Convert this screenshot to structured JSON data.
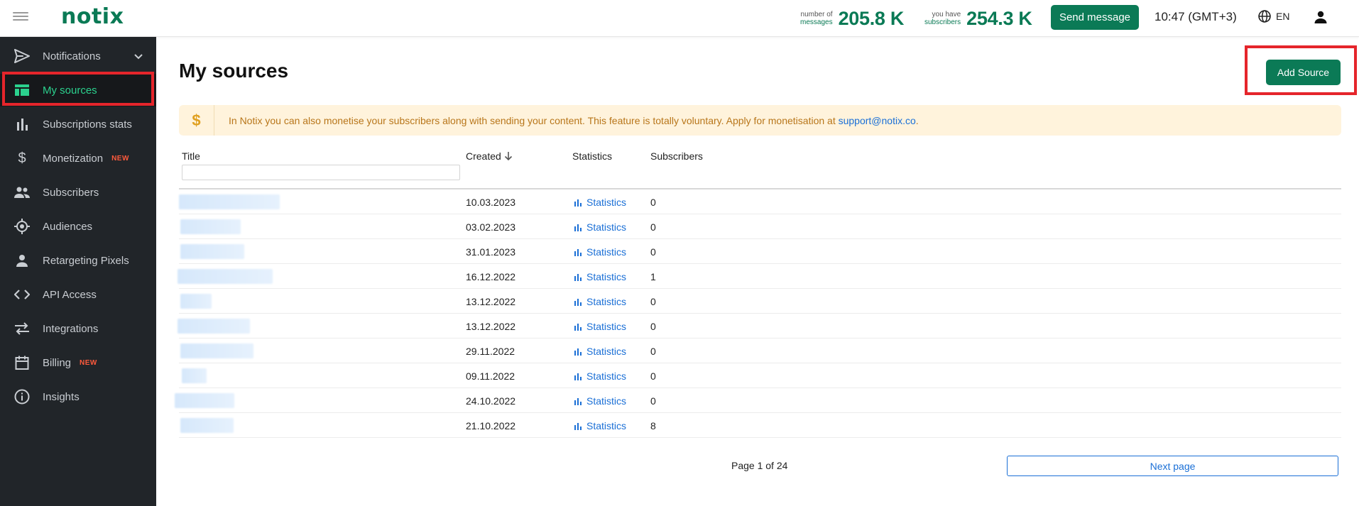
{
  "header": {
    "logo": "notix",
    "messages_label_1": "number of",
    "messages_label_2": "messages",
    "messages_value": "205.8 K",
    "subscribers_label_1": "you have",
    "subscribers_label_2": "subscribers",
    "subscribers_value": "254.3 K",
    "send_button": "Send message",
    "time": "10:47 (GMT+3)",
    "language": "EN"
  },
  "sidebar": {
    "items": [
      {
        "label": "Notifications",
        "icon": "send-icon"
      },
      {
        "label": "My sources",
        "icon": "table-icon",
        "active": true
      },
      {
        "label": "Subscriptions stats",
        "icon": "bar-chart-icon"
      },
      {
        "label": "Monetization",
        "icon": "dollar-icon",
        "badge": "NEW"
      },
      {
        "label": "Subscribers",
        "icon": "people-icon"
      },
      {
        "label": "Audiences",
        "icon": "target-icon"
      },
      {
        "label": "Retargeting Pixels",
        "icon": "person-icon"
      },
      {
        "label": "API Access",
        "icon": "code-icon"
      },
      {
        "label": "Integrations",
        "icon": "swap-icon"
      },
      {
        "label": "Billing",
        "icon": "calendar-icon",
        "badge": "NEW"
      },
      {
        "label": "Insights",
        "icon": "info-icon"
      }
    ]
  },
  "main": {
    "title": "My sources",
    "add_button": "Add Source",
    "banner_text": "In Notix you can also monetise your subscribers along with sending your content. This feature is totally voluntary. Apply for monetisation at ",
    "banner_link": "support@notix.co",
    "banner_end": ".",
    "columns": {
      "title": "Title",
      "created": "Created",
      "statistics": "Statistics",
      "subscribers": "Subscribers"
    },
    "rows": [
      {
        "created": "10.03.2023",
        "stat": "Statistics",
        "subscribers": "0"
      },
      {
        "created": "03.02.2023",
        "stat": "Statistics",
        "subscribers": "0"
      },
      {
        "created": "31.01.2023",
        "stat": "Statistics",
        "subscribers": "0"
      },
      {
        "created": "16.12.2022",
        "stat": "Statistics",
        "subscribers": "1"
      },
      {
        "created": "13.12.2022",
        "stat": "Statistics",
        "subscribers": "0"
      },
      {
        "created": "13.12.2022",
        "stat": "Statistics",
        "subscribers": "0"
      },
      {
        "created": "29.11.2022",
        "stat": "Statistics",
        "subscribers": "0"
      },
      {
        "created": "09.11.2022",
        "stat": "Statistics",
        "subscribers": "0"
      },
      {
        "created": "24.10.2022",
        "stat": "Statistics",
        "subscribers": "0"
      },
      {
        "created": "21.10.2022",
        "stat": "Statistics",
        "subscribers": "8"
      }
    ],
    "pager": "Page 1 of 24",
    "next_button": "Next page"
  },
  "colors": {
    "brand": "#0b7a56",
    "sidebar_bg": "#212529",
    "active_text": "#2bd18e",
    "link": "#1a6fd6",
    "highlight": "#e5252b"
  }
}
